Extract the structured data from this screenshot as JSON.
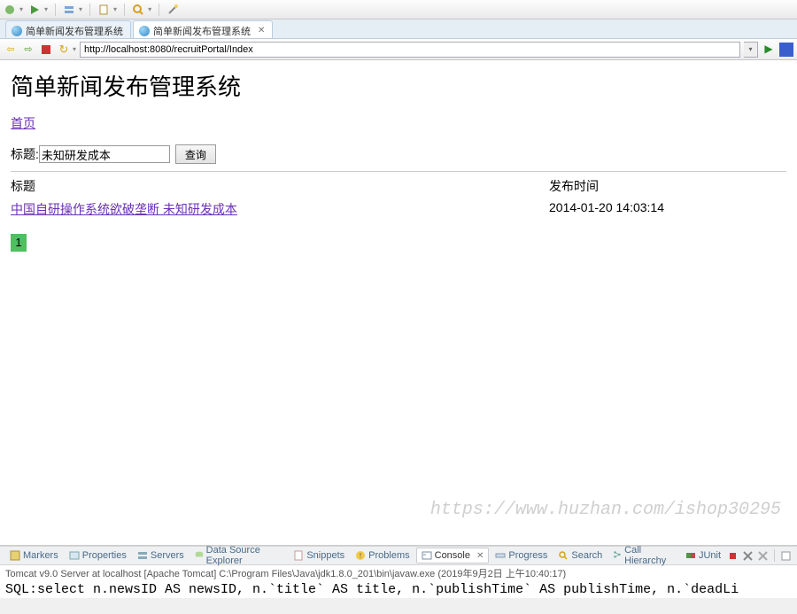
{
  "tabs": [
    {
      "label": "简单新闻发布管理系统",
      "active": false
    },
    {
      "label": "简单新闻发布管理系统",
      "active": true
    }
  ],
  "address": {
    "url": "http://localhost:8080/recruitPortal/Index"
  },
  "page": {
    "title": "简单新闻发布管理系统",
    "home_link": "首页",
    "search_label": "标题:",
    "search_value": "未知研发成本",
    "search_button": "查询",
    "columns": {
      "title": "标题",
      "time": "发布时间"
    },
    "rows": [
      {
        "title": "中国自研操作系统欲破垄断 未知研发成本",
        "time": "2014-01-20 14:03:14"
      }
    ],
    "pager_current": "1",
    "watermark": "https://www.huzhan.com/ishop30295"
  },
  "views": [
    {
      "label": "Markers"
    },
    {
      "label": "Properties"
    },
    {
      "label": "Servers"
    },
    {
      "label": "Data Source Explorer"
    },
    {
      "label": "Snippets"
    },
    {
      "label": "Problems"
    },
    {
      "label": "Console",
      "active": true
    },
    {
      "label": "Progress"
    },
    {
      "label": "Search"
    },
    {
      "label": "Call Hierarchy"
    },
    {
      "label": "JUnit"
    }
  ],
  "console": {
    "info": "Tomcat v9.0 Server at localhost [Apache Tomcat] C:\\Program Files\\Java\\jdk1.8.0_201\\bin\\javaw.exe (2019年9月2日 上午10:40:17)",
    "output": "SQL:select n.newsID AS newsID, n.`title` AS title, n.`publishTime` AS publishTime, n.`deadLi"
  }
}
